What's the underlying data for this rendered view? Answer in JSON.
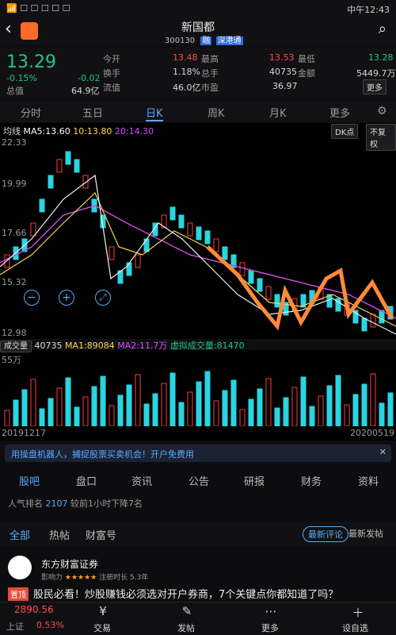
{
  "status": {
    "time": "中午12:43"
  },
  "header": {
    "title": "新国都",
    "code": "300130",
    "tag1": "融",
    "tag2": "深港通"
  },
  "quote": {
    "price": "13.29",
    "change": "-0.02",
    "pct": "-0.15%",
    "rows": [
      [
        {
          "l": "今开",
          "v": "13.48",
          "c": "red"
        },
        {
          "l": "最高",
          "v": "13.53",
          "c": "red"
        },
        {
          "l": "最低",
          "v": "13.28",
          "c": "green"
        }
      ],
      [
        {
          "l": "换手",
          "v": "1.18%",
          "c": ""
        },
        {
          "l": "总手",
          "v": "40735",
          "c": ""
        },
        {
          "l": "金额",
          "v": "5449.7万",
          "c": ""
        }
      ],
      [
        {
          "l": "总值",
          "v": "64.9亿",
          "c": ""
        },
        {
          "l": "流值",
          "v": "46.0亿",
          "c": ""
        },
        {
          "l": "市盈",
          "v": "36.97",
          "c": ""
        }
      ]
    ],
    "more": "更多"
  },
  "tabs": [
    "分时",
    "五日",
    "日K",
    "周K",
    "月K",
    "更多"
  ],
  "ma": {
    "label": "均线",
    "ma5": "MA5:13.60",
    "ma10": "10:13.80",
    "ma20": "20:14.30",
    "dk": "DK点",
    "fq": "不复权"
  },
  "axis": {
    "y1": "22.33",
    "y2": "19.99",
    "y3": "17.66",
    "y4": "15.32",
    "y5": "12.98",
    "vol": "55万",
    "date_start": "20191217",
    "date_end": "20200519"
  },
  "vol": {
    "label": "成交量",
    "v": "40735",
    "ma1": "MA1:89084",
    "ma2": "MA2:11.7万",
    "virtual": "虚拟成交量:81470"
  },
  "promo": {
    "text": "用操盘机器人，捕捉股票买卖机会！开户免费用"
  },
  "subtabs": [
    "股吧",
    "盘口",
    "资讯",
    "公告",
    "研报",
    "财务",
    "资料"
  ],
  "rank": {
    "label": "人气排名",
    "value": "2107",
    "tail": "较前1小时下降7名"
  },
  "feedtabs": [
    "全部",
    "热帖",
    "财富号"
  ],
  "sort": [
    "最新评论",
    "最新发帖"
  ],
  "post": {
    "author": "东方财富证券",
    "meta": "影响力",
    "stars": "★★★★★",
    "age": "注册时长",
    "years": "5.3年",
    "badge": "置顶",
    "title": "股民必看！炒股赚钱必须选对开户券商，7个关键点你都知道了吗？"
  },
  "bottom": {
    "index": "2890.56",
    "market": "上证",
    "pct": "0.53%",
    "items": [
      "交易",
      "发帖",
      "更多",
      "设自选"
    ]
  },
  "chart_data": {
    "type": "candlestick",
    "x_range": [
      "20191217",
      "20200519"
    ],
    "ylim": [
      12.98,
      22.33
    ],
    "y_ticks": [
      22.33,
      19.99,
      17.66,
      15.32,
      12.98
    ],
    "vol_max": "55万"
  }
}
